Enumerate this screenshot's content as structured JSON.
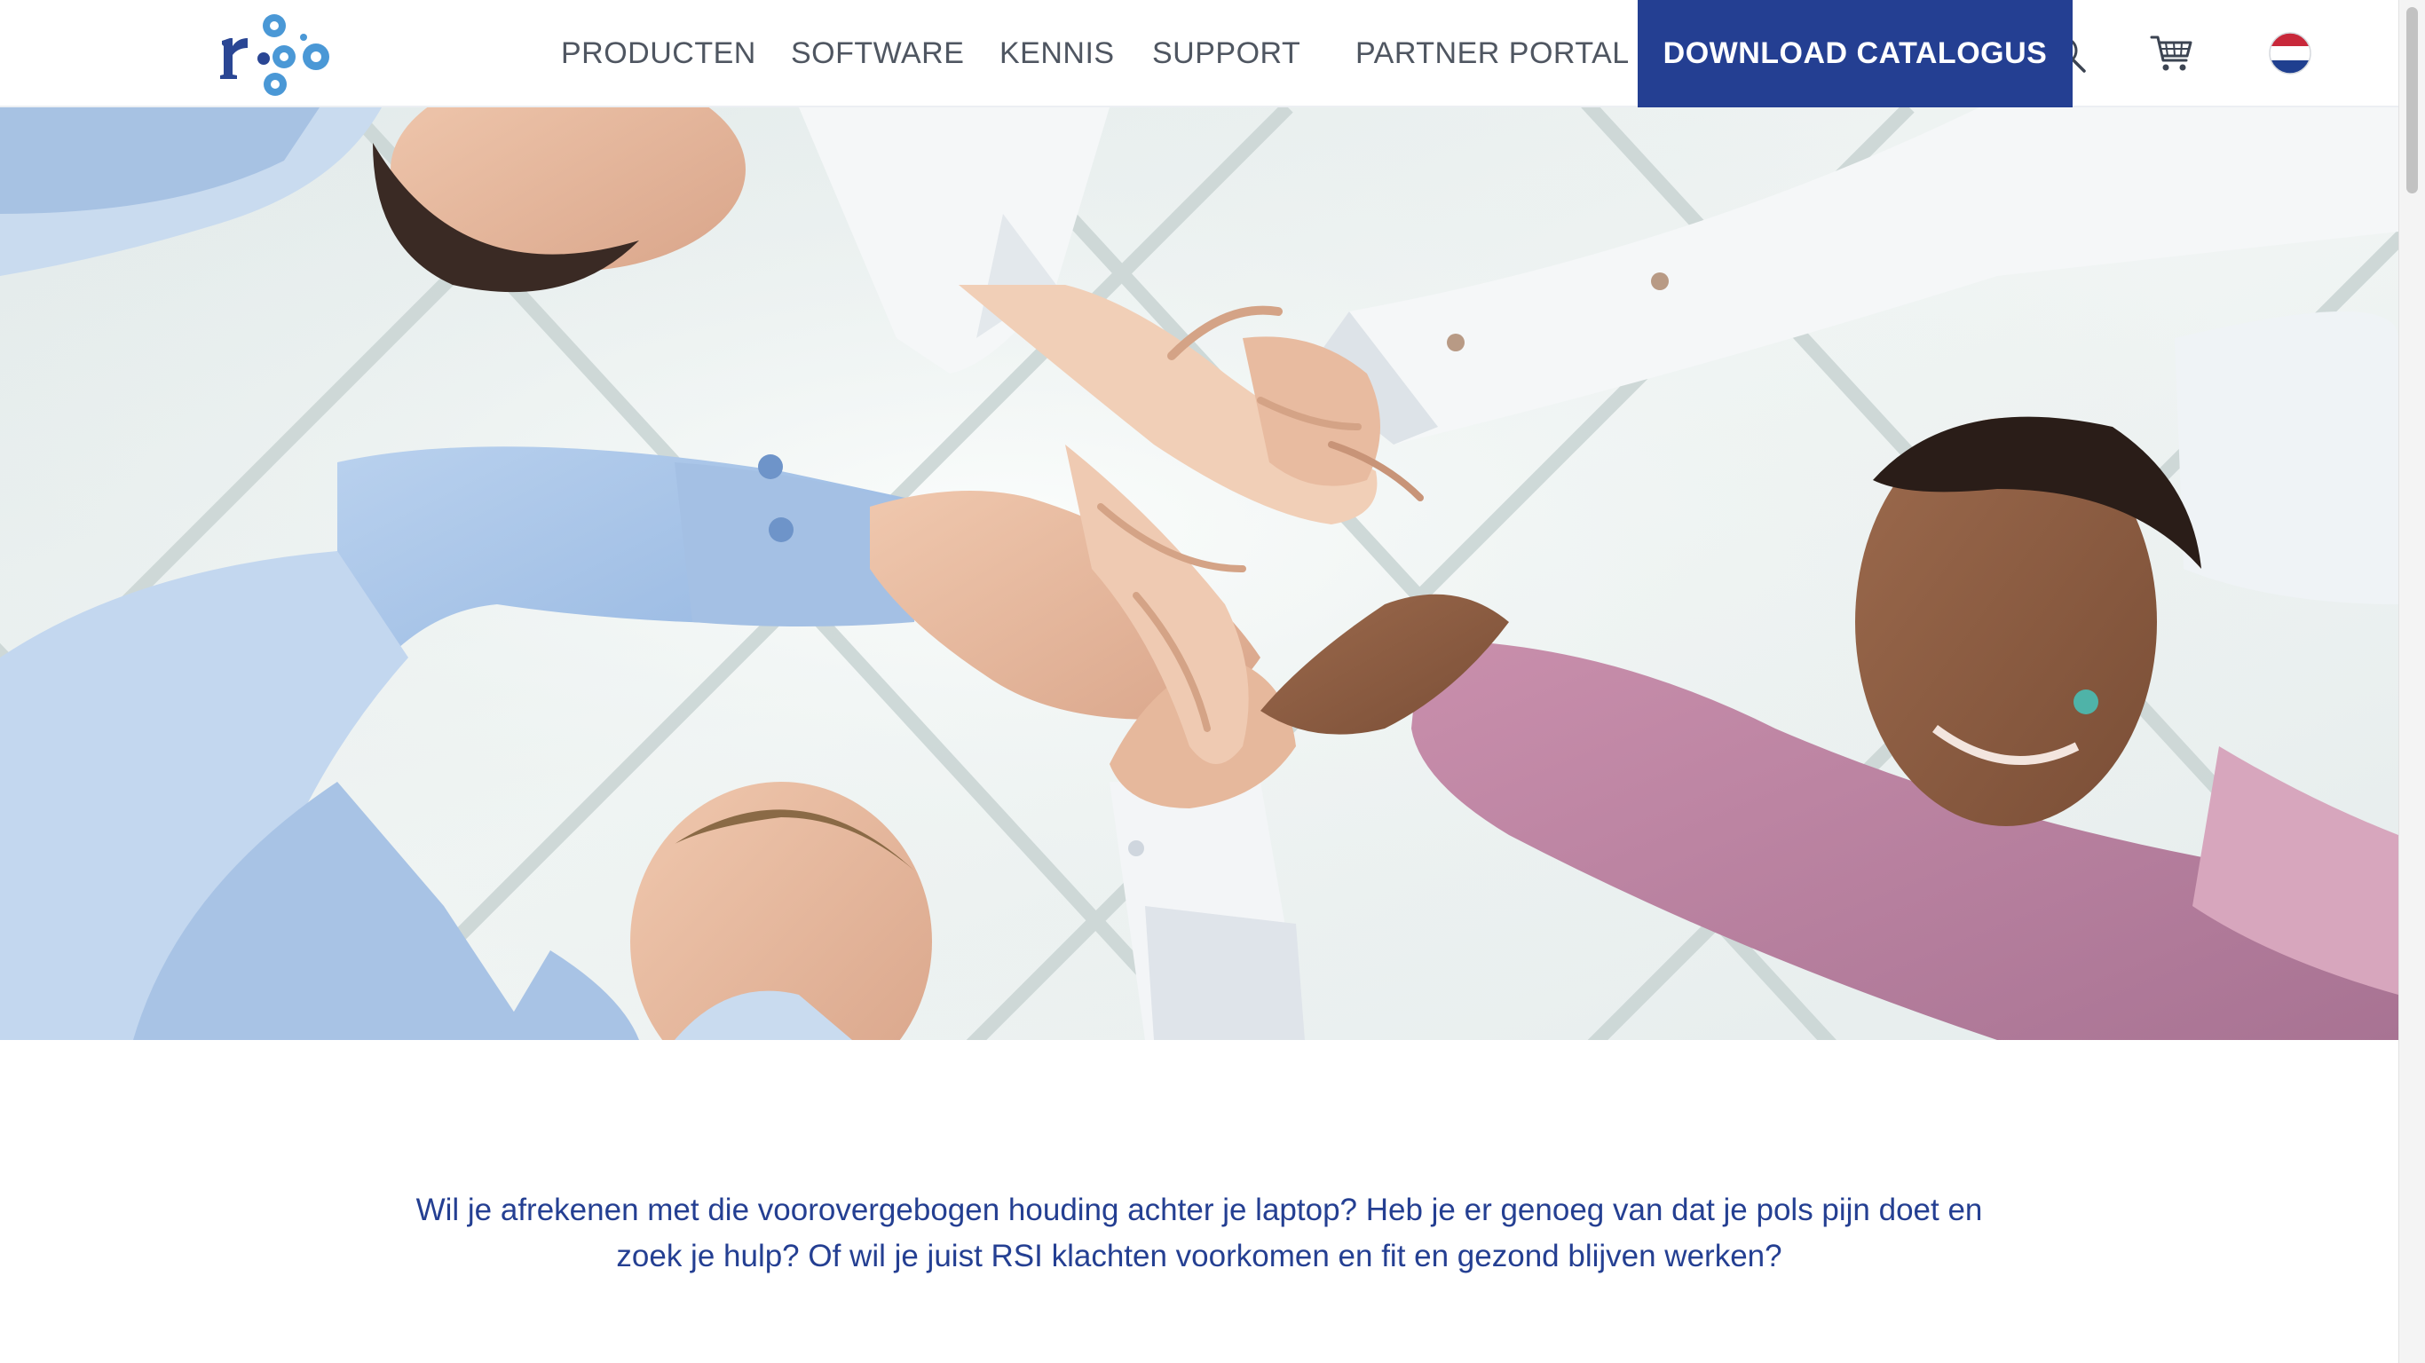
{
  "header": {
    "logo_alt": "r-go",
    "nav": [
      {
        "label": "PRODUCTEN"
      },
      {
        "label": "SOFTWARE"
      },
      {
        "label": "KENNIS"
      },
      {
        "label": "SUPPORT"
      },
      {
        "label": "PARTNER PORTAL"
      }
    ],
    "download_label": "DOWNLOAD CATALOGUS",
    "icons": {
      "search": "search-icon",
      "cart": "cart-icon",
      "language": "flag-nl-icon"
    }
  },
  "hero": {
    "image": "team-hands-stacked-photo"
  },
  "intro": {
    "line1": "Wil je afrekenen met die voorovergebogen houding achter je laptop? Heb je er genoeg van dat je pols pijn doet en",
    "line2": "zoek je hulp? Of wil je juist RSI klachten voorkomen en fit en gezond blijven werken?"
  },
  "colors": {
    "brand_blue": "#243f92",
    "logo_light_blue": "#4a98d6",
    "nav_text": "#4f5661",
    "intro_text": "#243f92"
  }
}
